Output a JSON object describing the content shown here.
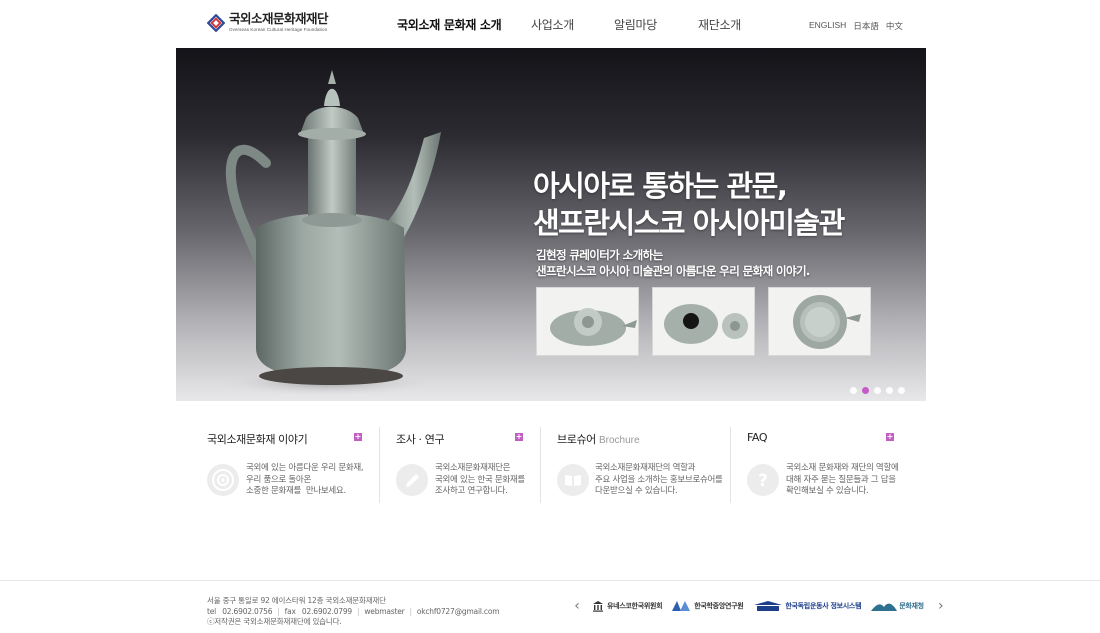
{
  "header": {
    "logo_title": "국외소재문화재재단",
    "logo_subtitle": "Overseas Korean Cultural Heritage Foundation",
    "nav": [
      {
        "label": "국외소재 문화재 소개"
      },
      {
        "label": "사업소개"
      },
      {
        "label": "알림마당"
      },
      {
        "label": "재단소개"
      }
    ],
    "langs": [
      "ENGLISH",
      "日本語",
      "中文"
    ]
  },
  "hero": {
    "title_line1": "아시아로 통하는 관문,",
    "title_line2": "샌프란시스코 아시아미술관",
    "desc_line1": "김현정 큐레이터가 소개하는",
    "desc_line2": "샌프란시스코 아시아 미술관의 아름다운 우리 문화재 이야기.",
    "slide_count": 5,
    "active_slide": 2
  },
  "sections": [
    {
      "title": "국외소재문화재 이야기",
      "title_en": "",
      "icon": "target-icon",
      "text": "국외에 있는 아름다운 우리 문화재,\n우리 품으로 돌아온\n소중한 문화재를  만나보세요."
    },
    {
      "title": "조사 · 연구",
      "title_en": "",
      "icon": "pencil-icon",
      "text": "국외소재문화재재단은\n국외에 있는 한국 문화재를\n조사하고 연구합니다."
    },
    {
      "title": "브로슈어",
      "title_en": "Brochure",
      "icon": "book-icon",
      "text": "국외소재문화재재단의 역할과\n주요 사업을 소개하는 홍보브로슈어를\n다운받으실 수 있습니다."
    },
    {
      "title": "FAQ",
      "title_en": "",
      "icon": "question-icon",
      "text": "국외소재 문화재와 재단의 역할에\n대해 자주 묻는 질문들과 그 답을\n확인해보실 수 있습니다."
    }
  ],
  "footer": {
    "address": "서울 중구 통일로 92 에이스타워 12층 국외소재문화재재단",
    "tel_label": "tel",
    "tel": "02.6902.0756",
    "fax_label": "fax",
    "fax": "02.6902.0799",
    "webmaster_label": "webmaster",
    "email": "okchf0727@gmail.com",
    "copyright": "ⓒ저작권은 국외소재문화재재단에 있습니다.",
    "partners": [
      "유네스코한국위원회",
      "한국학중앙연구원",
      "한국독립운동사 정보시스템",
      "문화재청"
    ]
  },
  "colors": {
    "accent": "#c25fc4",
    "logo_red": "#d23b3b",
    "logo_blue": "#2f4a9b"
  }
}
